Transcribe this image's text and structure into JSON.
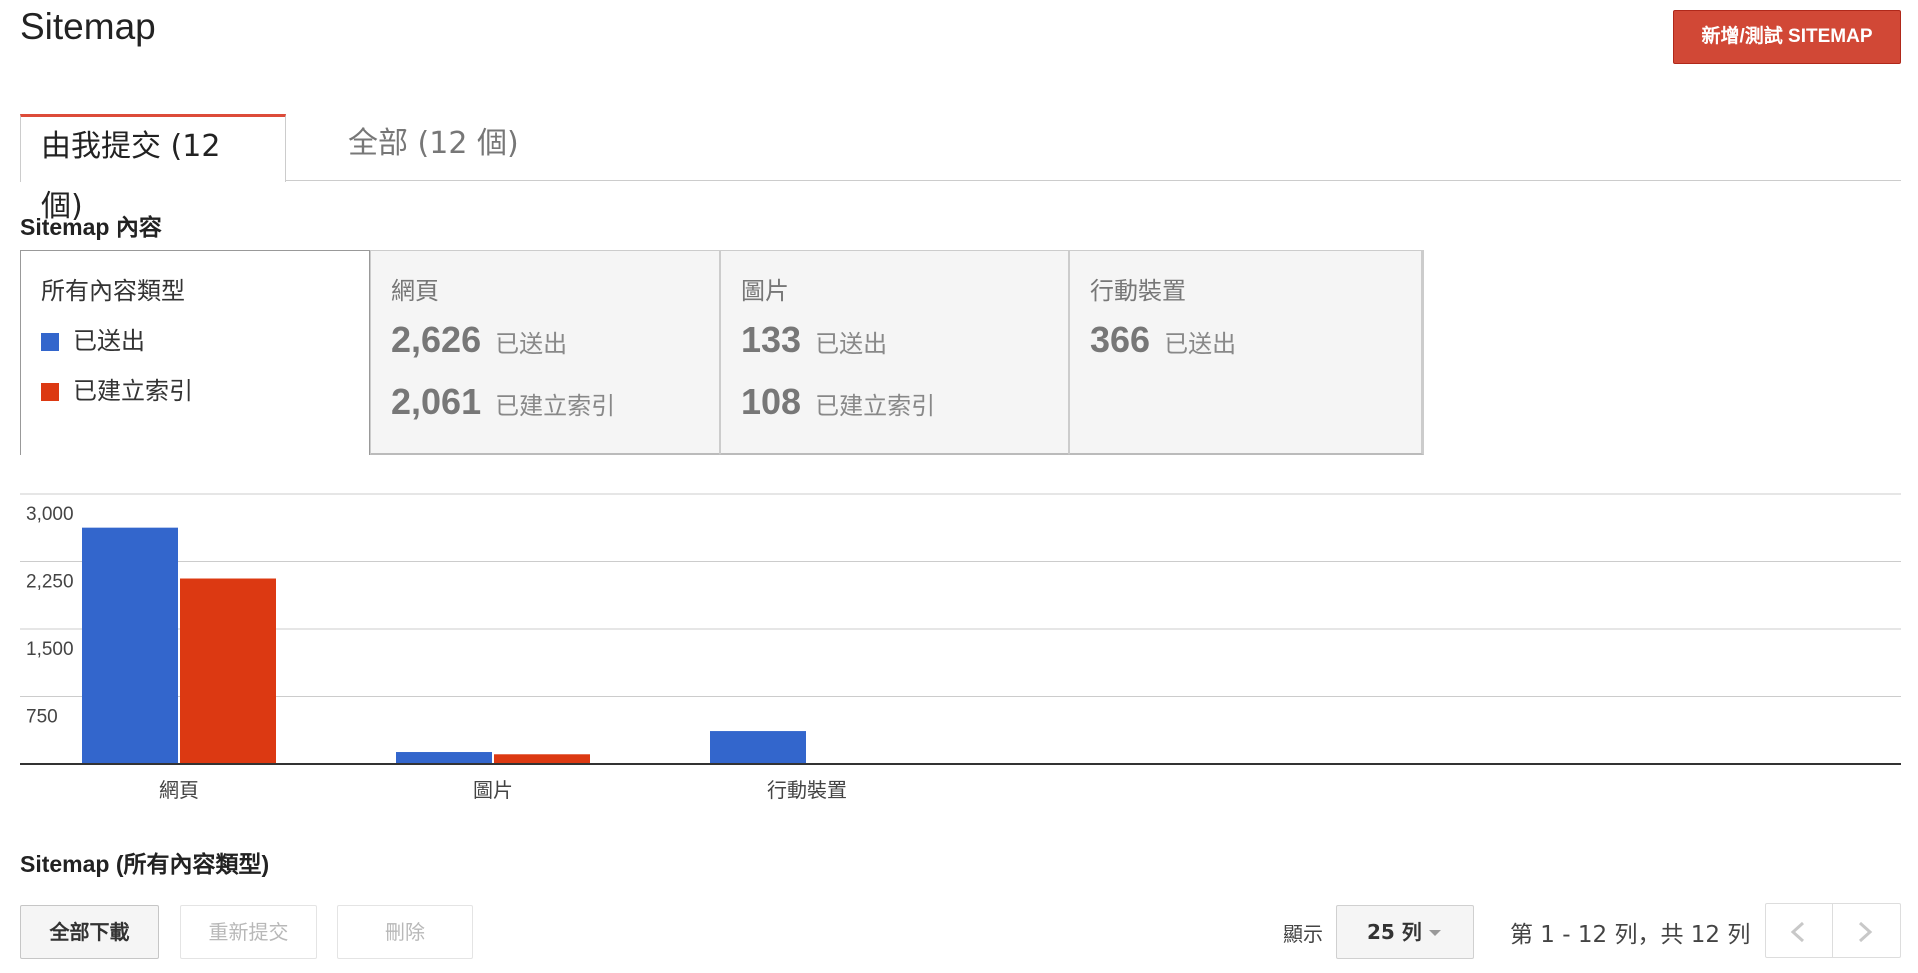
{
  "header": {
    "title": "Sitemap",
    "add_button_label": "新增/測試 SITEMAP"
  },
  "tabs": [
    {
      "label": "由我提交 (12 個)",
      "active": true
    },
    {
      "label": "全部 (12 個)",
      "active": false
    }
  ],
  "content_section_title": "Sitemap 內容",
  "summary": {
    "legend": {
      "heading": "所有內容類型",
      "items": [
        {
          "label": "已送出",
          "color": "#3366cc"
        },
        {
          "label": "已建立索引",
          "color": "#dc3912"
        }
      ]
    },
    "panels": [
      {
        "heading": "網頁",
        "submitted": "2,626",
        "submitted_label": "已送出",
        "indexed": "2,061",
        "indexed_label": "已建立索引"
      },
      {
        "heading": "圖片",
        "submitted": "133",
        "submitted_label": "已送出",
        "indexed": "108",
        "indexed_label": "已建立索引"
      },
      {
        "heading": "行動裝置",
        "submitted": "366",
        "submitted_label": "已送出"
      }
    ]
  },
  "chart_data": {
    "type": "bar",
    "categories": [
      "網頁",
      "圖片",
      "行動裝置"
    ],
    "series": [
      {
        "name": "已送出",
        "color": "#3366cc",
        "values": [
          2626,
          133,
          366
        ]
      },
      {
        "name": "已建立索引",
        "color": "#dc3912",
        "values": [
          2061,
          108,
          null
        ]
      }
    ],
    "yticks": [
      3000,
      2250,
      1500,
      750
    ],
    "ytick_labels": [
      "3,000",
      "2,250",
      "1,500",
      "750"
    ],
    "ylim": [
      0,
      3000
    ],
    "grid": true
  },
  "list_section_title": "Sitemap (所有內容類型)",
  "toolbar": {
    "download_label": "全部下載",
    "resubmit_label": "重新提交",
    "delete_label": "刪除",
    "show_label": "顯示",
    "rows_value": "25 列",
    "pager_text": "第 1 - 12 列，共 12 列"
  }
}
